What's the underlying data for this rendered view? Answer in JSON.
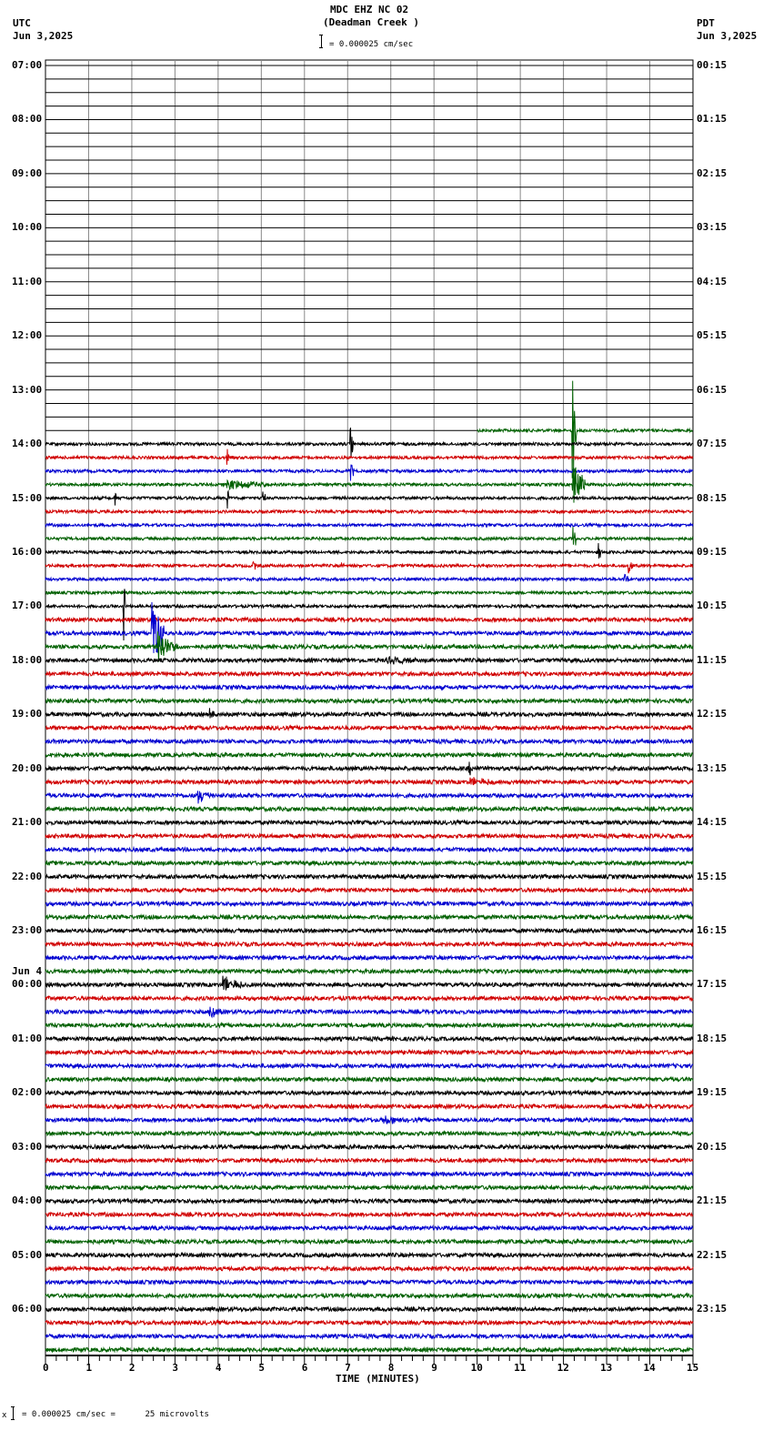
{
  "header": {
    "station": "MDC EHZ NC 02",
    "site": "(Deadman Creek )",
    "left_tz": "UTC",
    "left_date": "Jun 3,2025",
    "right_tz": "PDT",
    "right_date": "Jun 3,2025",
    "scale": "= 0.000025 cm/sec"
  },
  "footer": {
    "scale": "= 0.000025 cm/sec =      25 microvolts",
    "mark": "x"
  },
  "chart_data": {
    "type": "line",
    "title": "MDC EHZ NC 02 (Deadman Creek )",
    "xlabel": "TIME (MINUTES)",
    "xlim": [
      0,
      15
    ],
    "x_ticks": [
      "0",
      "1",
      "2",
      "3",
      "4",
      "5",
      "6",
      "7",
      "8",
      "9",
      "10",
      "11",
      "12",
      "13",
      "14",
      "15"
    ],
    "rows_per_hour": 4,
    "row_count": 96,
    "data_start_row": 27,
    "data_start_minute": 10,
    "trace_colors": [
      "#000000",
      "#d00000",
      "#0000d0",
      "#006000"
    ],
    "left_labels": [
      "07:00",
      "08:00",
      "09:00",
      "10:00",
      "11:00",
      "12:00",
      "13:00",
      "14:00",
      "15:00",
      "16:00",
      "17:00",
      "18:00",
      "19:00",
      "20:00",
      "21:00",
      "22:00",
      "23:00",
      "00:00",
      "01:00",
      "02:00",
      "03:00",
      "04:00",
      "05:00",
      "06:00"
    ],
    "date_change_label": "Jun 4",
    "right_labels": [
      "00:15",
      "01:15",
      "02:15",
      "03:15",
      "04:15",
      "05:15",
      "06:15",
      "07:15",
      "08:15",
      "09:15",
      "10:15",
      "11:15",
      "12:15",
      "13:15",
      "14:15",
      "15:15",
      "16:15",
      "17:15",
      "18:15",
      "19:15",
      "20:15",
      "21:15",
      "22:15",
      "23:15"
    ],
    "events": [
      {
        "row": 27,
        "minute": 12.2,
        "amp": 70,
        "dur": 0.1
      },
      {
        "row": 28,
        "minute": 7.05,
        "amp": 25,
        "dur": 0.1
      },
      {
        "row": 30,
        "minute": 7.05,
        "amp": 15,
        "dur": 0.1
      },
      {
        "row": 31,
        "minute": 12.2,
        "amp": 35,
        "dur": 0.3
      },
      {
        "row": 31,
        "minute": 4.2,
        "amp": 6,
        "dur": 1.0
      },
      {
        "row": 29,
        "minute": 4.2,
        "amp": 15,
        "dur": 0.05
      },
      {
        "row": 32,
        "minute": 4.2,
        "amp": 30,
        "dur": 0.05
      },
      {
        "row": 32,
        "minute": 5.0,
        "amp": 10,
        "dur": 0.1
      },
      {
        "row": 32,
        "minute": 1.6,
        "amp": 8,
        "dur": 0.1
      },
      {
        "row": 35,
        "minute": 12.2,
        "amp": 25,
        "dur": 0.1
      },
      {
        "row": 36,
        "minute": 12.8,
        "amp": 12,
        "dur": 0.1
      },
      {
        "row": 37,
        "minute": 4.8,
        "amp": 10,
        "dur": 0.1
      },
      {
        "row": 37,
        "minute": 6.85,
        "amp": 10,
        "dur": 0.1
      },
      {
        "row": 37,
        "minute": 13.5,
        "amp": 12,
        "dur": 0.1
      },
      {
        "row": 38,
        "minute": 13.4,
        "amp": 15,
        "dur": 0.1
      },
      {
        "row": 40,
        "minute": 1.8,
        "amp": 60,
        "dur": 0.05
      },
      {
        "row": 42,
        "minute": 2.45,
        "amp": 50,
        "dur": 0.3
      },
      {
        "row": 43,
        "minute": 2.6,
        "amp": 20,
        "dur": 0.5
      },
      {
        "row": 44,
        "minute": 7.9,
        "amp": 4,
        "dur": 0.7
      },
      {
        "row": 48,
        "minute": 3.8,
        "amp": 8,
        "dur": 0.1
      },
      {
        "row": 52,
        "minute": 9.8,
        "amp": 10,
        "dur": 0.2
      },
      {
        "row": 53,
        "minute": 9.8,
        "amp": 5,
        "dur": 0.8
      },
      {
        "row": 54,
        "minute": 3.5,
        "amp": 10,
        "dur": 0.3
      },
      {
        "row": 68,
        "minute": 4.1,
        "amp": 10,
        "dur": 0.5
      },
      {
        "row": 70,
        "minute": 3.8,
        "amp": 8,
        "dur": 0.3
      },
      {
        "row": 78,
        "minute": 7.8,
        "amp": 5,
        "dur": 0.6
      }
    ]
  }
}
